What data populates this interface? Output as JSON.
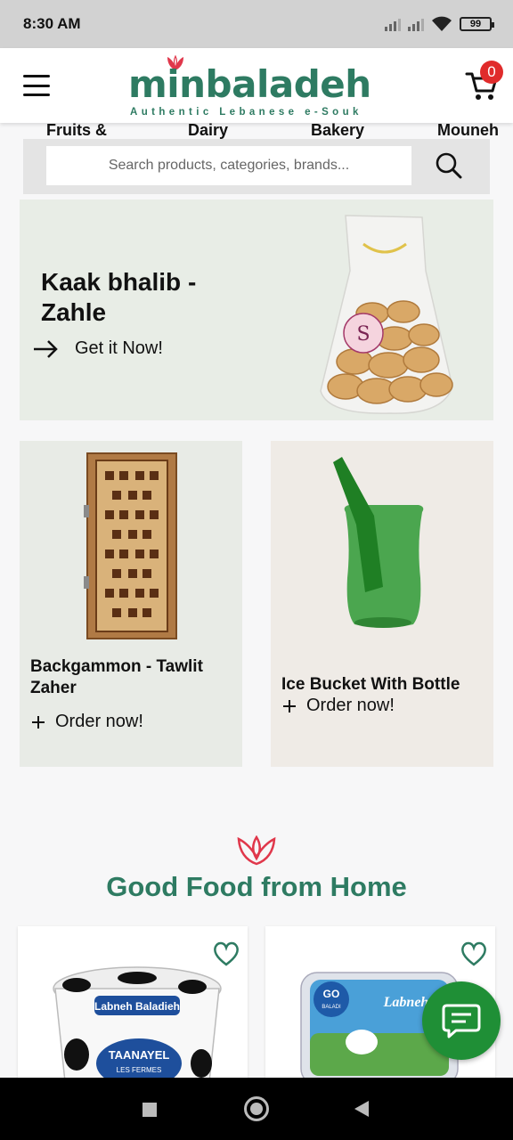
{
  "status_bar": {
    "time": "8:30 AM",
    "battery": "99"
  },
  "header": {
    "logo_text": "minbaladeh",
    "logo_tagline": "Authentic Lebanese e-Souk",
    "cart_count": "0",
    "brand_color": "#2e7b62",
    "badge_color": "#e02b2b"
  },
  "categories": [
    "Fruits &",
    "Dairy",
    "Bakery",
    "Mouneh"
  ],
  "search": {
    "placeholder": "Search products, categories, brands..."
  },
  "hero": {
    "title": "Kaak bhalib - Zahle",
    "cta": "Get it Now!"
  },
  "promos": [
    {
      "title": "Backgammon - Tawlit Zaher",
      "cta": "Order now!"
    },
    {
      "title": "Ice Bucket With Bottle",
      "cta": "Order now!"
    }
  ],
  "section": {
    "title": "Good Food from Home"
  },
  "products": [
    {
      "brand": "TAANAYEL",
      "brand_sub": "LES FERMES",
      "name": "Labneh Baladieh"
    },
    {
      "brand": "GO",
      "brand_sub": "BALADI",
      "name": "Labneh"
    }
  ],
  "chat": {
    "icon": "chat-icon",
    "color": "#1f8f36"
  }
}
